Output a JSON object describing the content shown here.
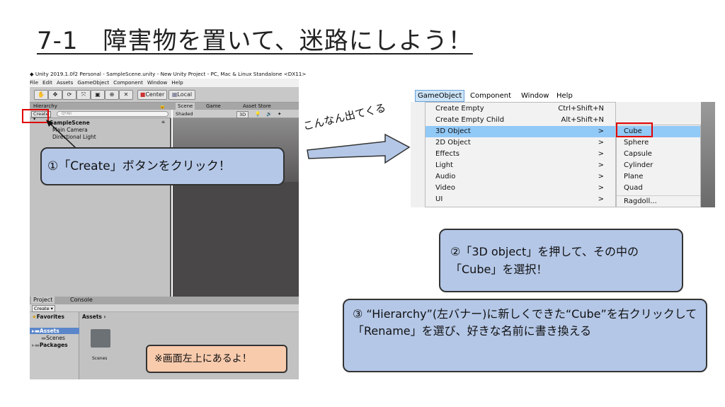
{
  "slide": {
    "title": "7-1　障害物を置いて、迷路にしよう！",
    "arrow_label": "こんなん出てくる"
  },
  "unity": {
    "window_title": "Unity 2019.1.0f2 Personal - SampleScene.unity - New Unity Project - PC, Mac & Linux Standalone <DX11>",
    "menu": [
      "File",
      "Edit",
      "Assets",
      "GameObject",
      "Component",
      "Window",
      "Help"
    ],
    "toolbar": {
      "center_label": "Center",
      "local_label": "Local"
    },
    "tabs": {
      "hierarchy": "Hierarchy",
      "scene": "Scene",
      "game": "Game",
      "asset_store": "Asset Store"
    },
    "hierarchy": {
      "create_label": "Create ▾",
      "search_placeholder": "Q*All",
      "scene_name": "SampleScene",
      "items": [
        "Main Camera",
        "Directional Light"
      ]
    },
    "scene_bar": {
      "shading": "Shaded",
      "mode": "3D"
    },
    "project": {
      "tabs": [
        "Project",
        "Console"
      ],
      "create_label": "Create ▾",
      "tree": [
        "Favorites",
        "Assets",
        "Scenes",
        "Packages"
      ],
      "breadcrumb": "Assets ›",
      "folder_label": "Scenes"
    }
  },
  "gameobject_menu": {
    "menubar": [
      "GameObject",
      "Component",
      "Window",
      "Help"
    ],
    "items": [
      {
        "label": "Create Empty",
        "shortcut": "Ctrl+Shift+N"
      },
      {
        "label": "Create Empty Child",
        "shortcut": "Alt+Shift+N"
      },
      {
        "label": "3D Object",
        "shortcut": ">"
      },
      {
        "label": "2D Object",
        "shortcut": ">"
      },
      {
        "label": "Effects",
        "shortcut": ">"
      },
      {
        "label": "Light",
        "shortcut": ">"
      },
      {
        "label": "Audio",
        "shortcut": ">"
      },
      {
        "label": "Video",
        "shortcut": ">"
      },
      {
        "label": "UI",
        "shortcut": ">"
      }
    ],
    "submenu": [
      "Cube",
      "Sphere",
      "Capsule",
      "Cylinder",
      "Plane",
      "Quad",
      "Ragdoll..."
    ]
  },
  "callouts": {
    "step1": "①「Create」ボタンをクリック！",
    "step2_line1": "②「3D object」を押して、その中の",
    "step2_line2": "「Cube」を選択！",
    "step3": "③ “Hierarchy”(左バナー)に新しくできた“Cube”を右クリックして「Rename」を選び、好きな名前に書き換える",
    "note": "※画面左上にあるよ！"
  },
  "colors": {
    "callout_blue": "#b4c7e7",
    "note_orange": "#f8cbad",
    "highlight_red": "#e00000",
    "menu_select": "#91c9f7"
  }
}
